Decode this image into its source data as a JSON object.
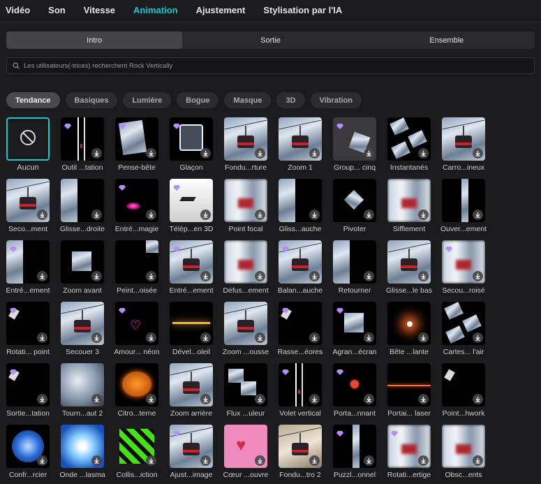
{
  "nav": {
    "items": [
      {
        "label": "Vidéo",
        "active": false
      },
      {
        "label": "Son",
        "active": false
      },
      {
        "label": "Vitesse",
        "active": false
      },
      {
        "label": "Animation",
        "active": true
      },
      {
        "label": "Ajustement",
        "active": false
      },
      {
        "label": "Stylisation par l'IA",
        "active": false
      }
    ]
  },
  "segments": [
    {
      "label": "Intro",
      "active": true
    },
    {
      "label": "Sortie",
      "active": false
    },
    {
      "label": "Ensemble",
      "active": false
    }
  ],
  "search": {
    "placeholder": "Les utilisateurs(-trices) recherchent Rock Vertically"
  },
  "chips": [
    {
      "label": "Tendance",
      "active": true
    },
    {
      "label": "Basiques",
      "active": false
    },
    {
      "label": "Lumière",
      "active": false
    },
    {
      "label": "Bogue",
      "active": false
    },
    {
      "label": "Masque",
      "active": false
    },
    {
      "label": "3D",
      "active": false
    },
    {
      "label": "Vibration",
      "active": false
    }
  ],
  "colors": {
    "accent": "#28c3d1",
    "premium_gem": "#b98bff",
    "background": "#1b1b1d"
  },
  "effects": [
    {
      "label": "Aucun",
      "style": "none",
      "premium": false,
      "download": false
    },
    {
      "label": "Outil ...tation",
      "style": "lines",
      "premium": true,
      "download": true
    },
    {
      "label": "Pense-bête",
      "style": "note",
      "premium": true,
      "download": true
    },
    {
      "label": "Glaçon",
      "style": "ice",
      "premium": true,
      "download": true
    },
    {
      "label": "Fondu...rture",
      "style": "snow",
      "premium": false,
      "download": true
    },
    {
      "label": "Zoom 1",
      "style": "snow",
      "premium": false,
      "download": true
    },
    {
      "label": "Group... cinq",
      "style": "gray",
      "premium": true,
      "download": true
    },
    {
      "label": "Instantanés",
      "style": "tilt",
      "premium": false,
      "download": true
    },
    {
      "label": "Carro...ineux",
      "style": "snow",
      "premium": false,
      "download": true
    },
    {
      "label": "Seco...ment",
      "style": "snow",
      "premium": false,
      "download": true
    },
    {
      "label": "Glisse...droite",
      "style": "half",
      "premium": false,
      "download": true
    },
    {
      "label": "Entré...magie",
      "style": "pink",
      "premium": true,
      "download": true
    },
    {
      "label": "Télép...en 3D",
      "style": "white",
      "premium": true,
      "download": true
    },
    {
      "label": "Point focal",
      "style": "blur",
      "premium": false,
      "download": true
    },
    {
      "label": "Gliss...auche",
      "style": "half",
      "premium": false,
      "download": true
    },
    {
      "label": "Pivoter",
      "style": "diamond",
      "premium": false,
      "download": true
    },
    {
      "label": "Sifflement",
      "style": "blur",
      "premium": false,
      "download": true
    },
    {
      "label": "Ouver...ement",
      "style": "split",
      "premium": false,
      "download": true
    },
    {
      "label": "Entré...ement",
      "style": "half",
      "premium": true,
      "download": true
    },
    {
      "label": "Zoom avant",
      "style": "small",
      "premium": false,
      "download": true
    },
    {
      "label": "Peint...oisée",
      "style": "corner",
      "premium": false,
      "download": true
    },
    {
      "label": "Entré...ement",
      "style": "snow",
      "premium": true,
      "download": true
    },
    {
      "label": "Défus...ement",
      "style": "blur",
      "premium": false,
      "download": true
    },
    {
      "label": "Balan...auche",
      "style": "snow",
      "premium": true,
      "download": true
    },
    {
      "label": "Retourner",
      "style": "half",
      "premium": false,
      "download": true
    },
    {
      "label": "Glisse...le bas",
      "style": "snow",
      "premium": false,
      "download": true
    },
    {
      "label": "Secou...roisé",
      "style": "blur",
      "premium": true,
      "download": true
    },
    {
      "label": "Rotati... point",
      "style": "dark",
      "premium": true,
      "download": true
    },
    {
      "label": "Secouer 3",
      "style": "snow",
      "premium": false,
      "download": true
    },
    {
      "label": "Amour... néon",
      "style": "heart-neon",
      "premium": true,
      "download": true
    },
    {
      "label": "Dével...oleil",
      "style": "flare",
      "premium": false,
      "download": true
    },
    {
      "label": "Zoom ...ousse",
      "style": "snow",
      "premium": false,
      "download": true
    },
    {
      "label": "Rasse...éores",
      "style": "dark",
      "premium": true,
      "download": true
    },
    {
      "label": "Agran...écran",
      "style": "small",
      "premium": true,
      "download": true
    },
    {
      "label": "Bête ...lante",
      "style": "burst",
      "premium": false,
      "download": true
    },
    {
      "label": "Cartes... l'air",
      "style": "tilt",
      "premium": false,
      "download": true
    },
    {
      "label": "Sortie...tation",
      "style": "dark",
      "premium": true,
      "download": true
    },
    {
      "label": "Tourn...aut 2",
      "style": "swirl",
      "premium": false,
      "download": true
    },
    {
      "label": "Citro...terne",
      "style": "pumpkin",
      "premium": false,
      "download": true
    },
    {
      "label": "Zoom arrière",
      "style": "snow",
      "premium": false,
      "download": true
    },
    {
      "label": "Flux ...uleur",
      "style": "grid",
      "premium": false,
      "download": true
    },
    {
      "label": "Volet vertical",
      "style": "lines",
      "premium": true,
      "download": true
    },
    {
      "label": "Porta...nnant",
      "style": "orb",
      "premium": true,
      "download": true
    },
    {
      "label": "Portai... laser",
      "style": "laser",
      "premium": false,
      "download": true
    },
    {
      "label": "Point...hwork",
      "style": "dark",
      "premium": false,
      "download": true
    },
    {
      "label": "Confr...rcier",
      "style": "portal-blue",
      "premium": false,
      "download": true
    },
    {
      "label": "Onde ...lasma",
      "style": "plasma",
      "premium": false,
      "download": true
    },
    {
      "label": "Collis...iction",
      "style": "green",
      "premium": false,
      "download": true
    },
    {
      "label": "Ajust...image",
      "style": "snow",
      "premium": true,
      "download": true
    },
    {
      "label": "Cœur ...ouvre",
      "style": "heart-pink",
      "premium": false,
      "download": true
    },
    {
      "label": "Fondu...tro 2",
      "style": "sepia",
      "premium": false,
      "download": true
    },
    {
      "label": "Puzzl...onnel",
      "style": "split",
      "premium": true,
      "download": true
    },
    {
      "label": "Rotati...ertige",
      "style": "blur",
      "premium": true,
      "download": true
    },
    {
      "label": "Obsc...ents",
      "style": "blur",
      "premium": false,
      "download": true
    }
  ]
}
